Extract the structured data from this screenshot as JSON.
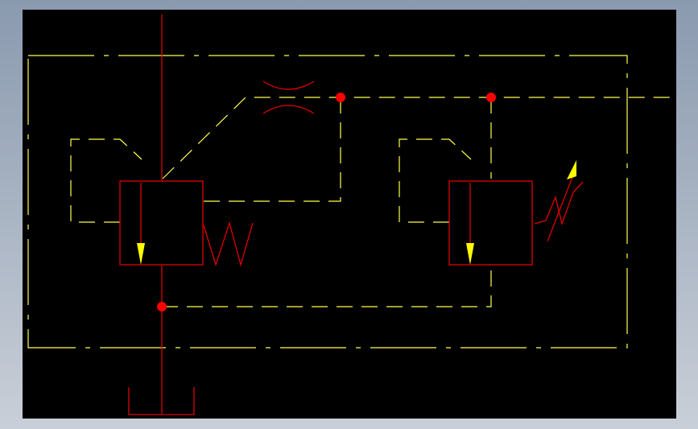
{
  "colors": {
    "frame_top": "#8a9aaf",
    "frame_bottom": "#c9cfd8",
    "canvas": "#000000",
    "pilot_line": "#ffff4d",
    "main_line": "#e00000",
    "junction": "#ff0000",
    "arrow_fill": "#ffff00"
  },
  "symbols": [
    {
      "name": "boundary-enclosure",
      "kind": "dash-dot rectangle"
    },
    {
      "name": "pressure-reducing-valve",
      "kind": "spring-loaded valve with internal flow arrow"
    },
    {
      "name": "relief-pilot-valve",
      "kind": "adjustable spring-loaded valve"
    },
    {
      "name": "fixed-orifice",
      "kind": "restrictor"
    },
    {
      "name": "tank",
      "kind": "reservoir"
    },
    {
      "name": "pilot-lines",
      "kind": "dashed control lines"
    },
    {
      "name": "junction-dots",
      "count": 3
    }
  ]
}
